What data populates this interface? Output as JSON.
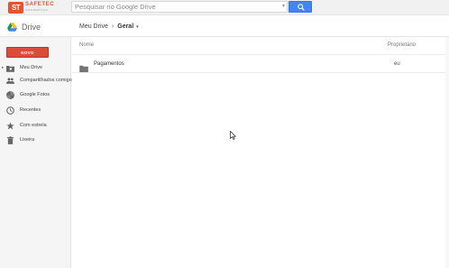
{
  "header": {
    "logo_mark": "ST",
    "logo_brand": "SAFETEC",
    "logo_sub": "INFORMÁTICA",
    "search_placeholder": "Pesquisar no Google Drive",
    "search_caret": "▾"
  },
  "app": {
    "title": "Drive",
    "breadcrumb": {
      "parent": "Meu Drive",
      "separator": "›",
      "current": "Geral",
      "caret": "▾"
    }
  },
  "sidebar": {
    "new_label": "NOVO",
    "items": [
      {
        "label": "Meu Drive",
        "icon": "folder-icon",
        "expand": "▸"
      },
      {
        "label": "Compartilhados comigo",
        "icon": "people-icon"
      },
      {
        "label": "Google Fotos",
        "icon": "photos-icon"
      },
      {
        "label": "Recentes",
        "icon": "clock-icon"
      },
      {
        "label": "Com estrela",
        "icon": "star-icon"
      },
      {
        "label": "Lixeira",
        "icon": "trash-icon"
      }
    ]
  },
  "table": {
    "columns": [
      "Nome",
      "Proprietário"
    ],
    "rows": [
      {
        "name": "Pagamentos",
        "owner": "eu",
        "icon": "folder-icon"
      }
    ]
  },
  "colors": {
    "accent_red": "#dd4b39",
    "search_blue": "#4285f4",
    "logo_orange": "#e8522f"
  }
}
